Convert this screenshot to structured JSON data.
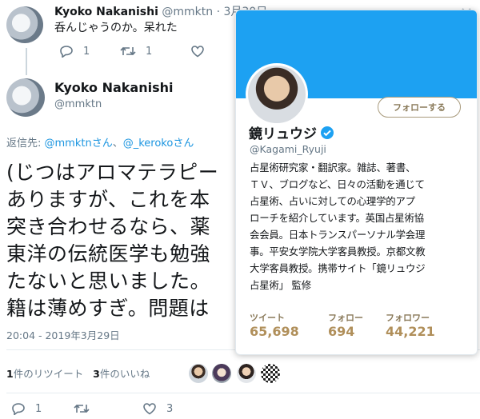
{
  "reply_tweet": {
    "author_name": "Kyoko Nakanishi",
    "author_handle": "@mmktn",
    "date": "3月30日",
    "text": "呑んじゃうのか。呆れた",
    "reply_count": "1",
    "retweet_count": "1"
  },
  "main_tweet": {
    "author_name": "Kyoko Nakanishi",
    "author_handle": "@mmktn",
    "reply_prefix": "返信先: ",
    "reply_to_1": "@mmktnさん",
    "reply_sep": "、",
    "reply_to_2": "@_kerokoさん",
    "lines": [
      "(じつはアロマテラピー",
      "ありますが、これを本",
      "突き合わせるなら、薬",
      "東洋の伝統医学も勉強",
      "たないと思いました。",
      "籍は薄めすぎ。問題は"
    ],
    "timestamp": "20:04 - 2019年3月29日",
    "retweets_count": "1",
    "retweets_label": "件のリツイート",
    "likes_count": "3",
    "likes_label": "件のいいね",
    "action_reply_count": "1",
    "action_like_count": "3"
  },
  "hover_card": {
    "display_name": "鏡リュウジ",
    "handle": "@Kagami_Ryuji",
    "follow_label": "フォローする",
    "bio_lines": [
      "占星術研究家・翻訳家。雑誌、著書、",
      "ＴＶ、ブログなど、日々の活動を通じて",
      "占星術、占いに対しての心理学的アプ",
      "ローチを紹介しています。英国占星術協",
      "会会員。日本トランスパーソナル学会理",
      "事。平安女学院大学客員教授。京都文教",
      "大学客員教授。携帯サイト「鏡リュウジ",
      "占星術」 監修"
    ],
    "stats": [
      {
        "label": "ツイート",
        "value": "65,698"
      },
      {
        "label": "フォロー",
        "value": "694"
      },
      {
        "label": "フォロワー",
        "value": "44,221"
      }
    ],
    "accent": "#1da1f2"
  }
}
